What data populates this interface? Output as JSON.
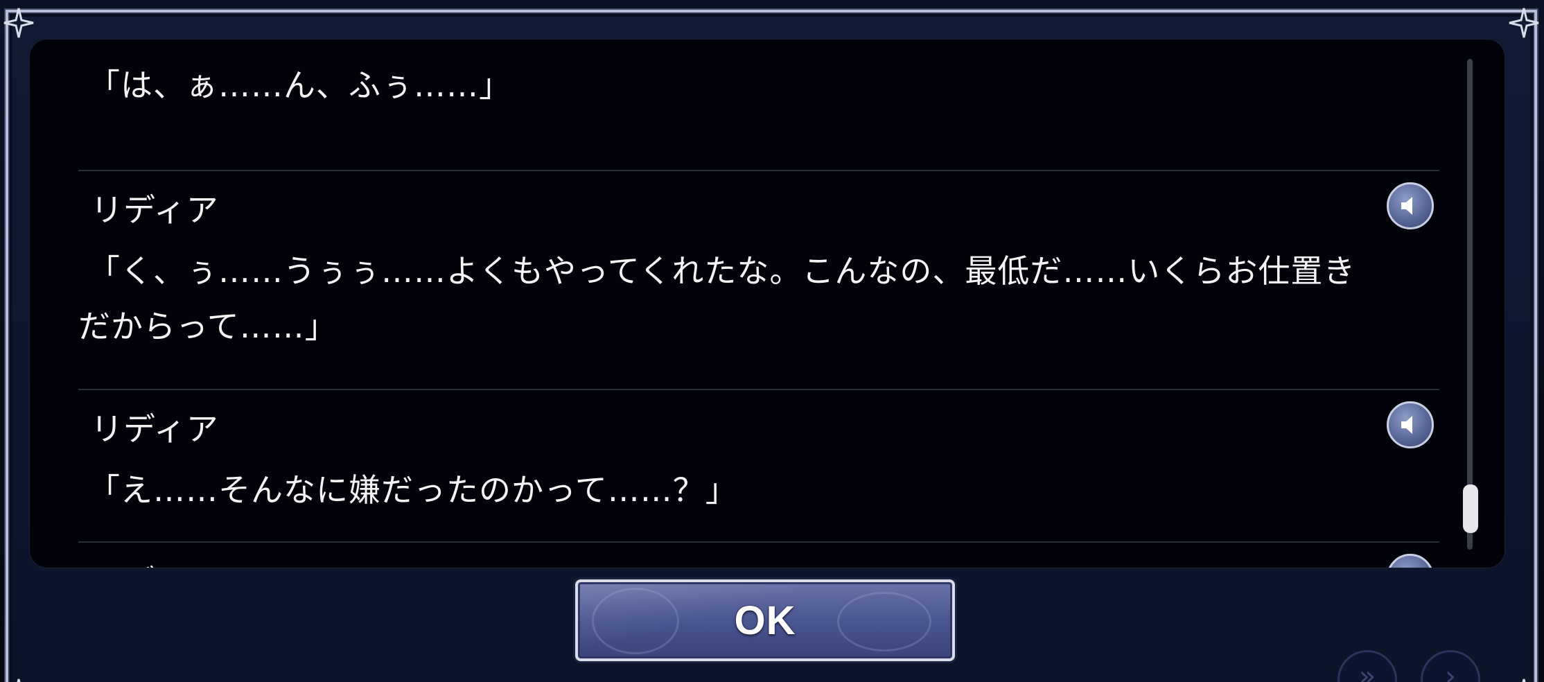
{
  "log": {
    "entries": [
      {
        "speaker": "",
        "lines": [
          "「は、ぁ……ん、ふぅ……」"
        ],
        "has_voice": false
      },
      {
        "speaker": "リディア",
        "lines": [
          "「く、ぅ……うぅぅ……よくもやってくれたな。こんなの、最低だ……いくらお仕置き",
          "だからって……」"
        ],
        "has_voice": true
      },
      {
        "speaker": "リディア",
        "lines": [
          "「え……そんなに嫌だったのかって……？」"
        ],
        "has_voice": true
      },
      {
        "speaker": "リディア",
        "lines": [],
        "has_voice": true
      }
    ],
    "voice_icon": "speaker-icon"
  },
  "buttons": {
    "ok_label": "OK"
  },
  "colors": {
    "panel_bg": "#02030a",
    "frame": "#b8bfd4",
    "button": "#4b5590",
    "text": "#f4f4f4"
  }
}
